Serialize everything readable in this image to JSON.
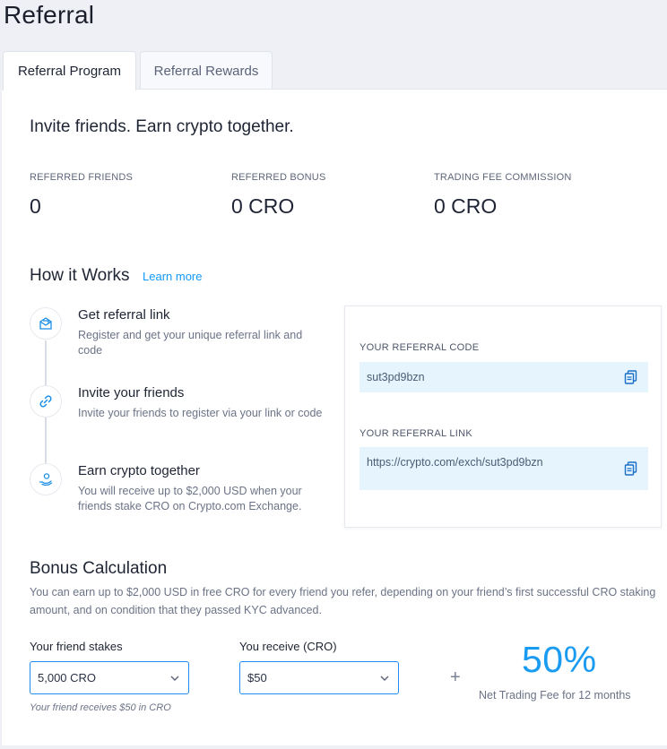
{
  "page_title": "Referral",
  "tabs": [
    {
      "label": "Referral Program",
      "active": true
    },
    {
      "label": "Referral Rewards",
      "active": false
    }
  ],
  "headline": "Invite friends. Earn crypto together.",
  "stats": [
    {
      "label": "REFERRED FRIENDS",
      "value": "0"
    },
    {
      "label": "REFERRED BONUS",
      "value": "0 CRO"
    },
    {
      "label": "TRADING FEE COMMISSION",
      "value": "0 CRO"
    }
  ],
  "how_it_works": {
    "title": "How it Works",
    "learn_more": "Learn more",
    "steps": [
      {
        "icon": "envelope-icon",
        "title": "Get referral link",
        "desc": "Register and get your unique referral link and code"
      },
      {
        "icon": "link-icon",
        "title": "Invite your friends",
        "desc": "Invite your friends to register via your link or code"
      },
      {
        "icon": "coin-hand-icon",
        "title": "Earn crypto together",
        "desc": "You will receive up to $2,000 USD when your friends stake CRO on Crypto.com Exchange."
      }
    ]
  },
  "referral_box": {
    "code_label": "YOUR REFERRAL CODE",
    "code_value": "sut3pd9bzn",
    "link_label": "YOUR REFERRAL LINK",
    "link_value": "https://crypto.com/exch/sut3pd9bzn"
  },
  "bonus": {
    "title": "Bonus Calculation",
    "desc": "You can earn up to $2,000 USD in free CRO for every friend you refer, depending on your friend’s first successful CRO staking amount, and on condition that they passed KYC advanced.",
    "stake_label": "Your friend stakes",
    "stake_value": "5,000 CRO",
    "receive_label": "You receive (CRO)",
    "receive_value": "$50",
    "friend_note": "Your friend receives $50 in CRO",
    "plus": "+",
    "percent": "50%",
    "fee_text": "Net Trading Fee for 12 months"
  },
  "colors": {
    "accent": "#1199fa",
    "field_bg": "#e6f4fd",
    "page_bg": "#eef0f6"
  }
}
